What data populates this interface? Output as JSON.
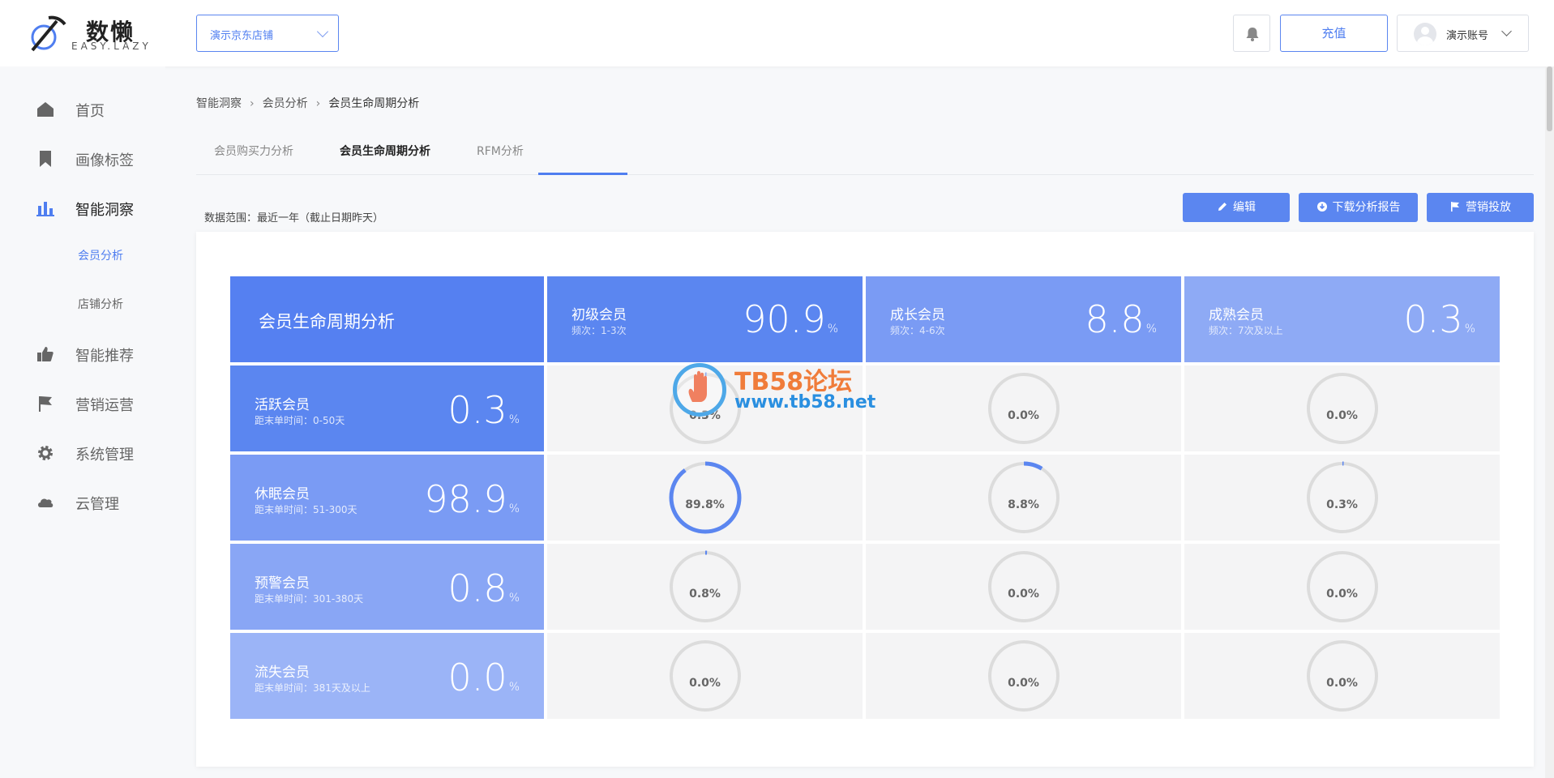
{
  "brand": {
    "title": "数懒",
    "subtitle": "EASY.LAZY"
  },
  "header": {
    "store_select": "演示京东店铺",
    "recharge_label": "充值",
    "account_name": "演示账号"
  },
  "sidebar": {
    "items": [
      {
        "label": "首页",
        "icon": "home-icon"
      },
      {
        "label": "画像标签",
        "icon": "bookmark-icon"
      },
      {
        "label": "智能洞察",
        "icon": "bar-chart-icon"
      },
      {
        "label": "智能推荐",
        "icon": "thumbs-up-icon"
      },
      {
        "label": "营销运营",
        "icon": "flag-icon"
      },
      {
        "label": "系统管理",
        "icon": "gear-icon"
      },
      {
        "label": "云管理",
        "icon": "cloud-icon"
      }
    ],
    "sub_items": [
      {
        "label": "会员分析",
        "active": true
      },
      {
        "label": "店铺分析",
        "active": false
      }
    ]
  },
  "breadcrumb": [
    "智能洞察",
    "会员分析",
    "会员生命周期分析"
  ],
  "tabs": [
    {
      "label": "会员购买力分析",
      "active": false
    },
    {
      "label": "会员生命周期分析",
      "active": true
    },
    {
      "label": "RFM分析",
      "active": false
    }
  ],
  "range_text": "数据范围：最近一年（截止日期昨天）",
  "actions": {
    "edit": "编辑",
    "download": "下载分析报告",
    "marketing": "营销投放"
  },
  "matrix": {
    "title": "会员生命周期分析",
    "percent_sign": "%",
    "columns": [
      {
        "name": "初级会员",
        "sub": "频次：1-3次",
        "value": "90.9",
        "color": "#5b86f0"
      },
      {
        "name": "成长会员",
        "sub": "频次：4-6次",
        "value": "8.8",
        "color": "#7a9bf4"
      },
      {
        "name": "成熟会员",
        "sub": "频次：7次及以上",
        "value": "0.3",
        "color": "#8eaaf5"
      }
    ],
    "rows": [
      {
        "name": "活跃会员",
        "sub": "距末单时间：0-50天",
        "value": "0.3",
        "color": "#5b86f0",
        "cells": [
          "0.3%",
          "0.0%",
          "0.0%"
        ],
        "fractions": [
          0.003,
          0.0,
          0.0
        ]
      },
      {
        "name": "休眠会员",
        "sub": "距末单时间：51-300天",
        "value": "98.9",
        "color": "#7a9bf4",
        "cells": [
          "89.8%",
          "8.8%",
          "0.3%"
        ],
        "fractions": [
          0.898,
          0.088,
          0.003
        ]
      },
      {
        "name": "预警会员",
        "sub": "距末单时间：301-380天",
        "value": "0.8",
        "color": "#89a6f5",
        "cells": [
          "0.8%",
          "0.0%",
          "0.0%"
        ],
        "fractions": [
          0.008,
          0.0,
          0.0
        ]
      },
      {
        "name": "流失会员",
        "sub": "距末单时间：381天及以上",
        "value": "0.0",
        "color": "#9bb4f7",
        "cells": [
          "0.0%",
          "0.0%",
          "0.0%"
        ],
        "fractions": [
          0.0,
          0.0,
          0.0
        ]
      }
    ]
  },
  "watermark": {
    "line1": "TB58论坛",
    "line2": "www.tb58.net"
  },
  "colors": {
    "accent": "#5b86f0",
    "ring_track": "#dcdcdc",
    "cell_bg": "#f4f4f5"
  }
}
